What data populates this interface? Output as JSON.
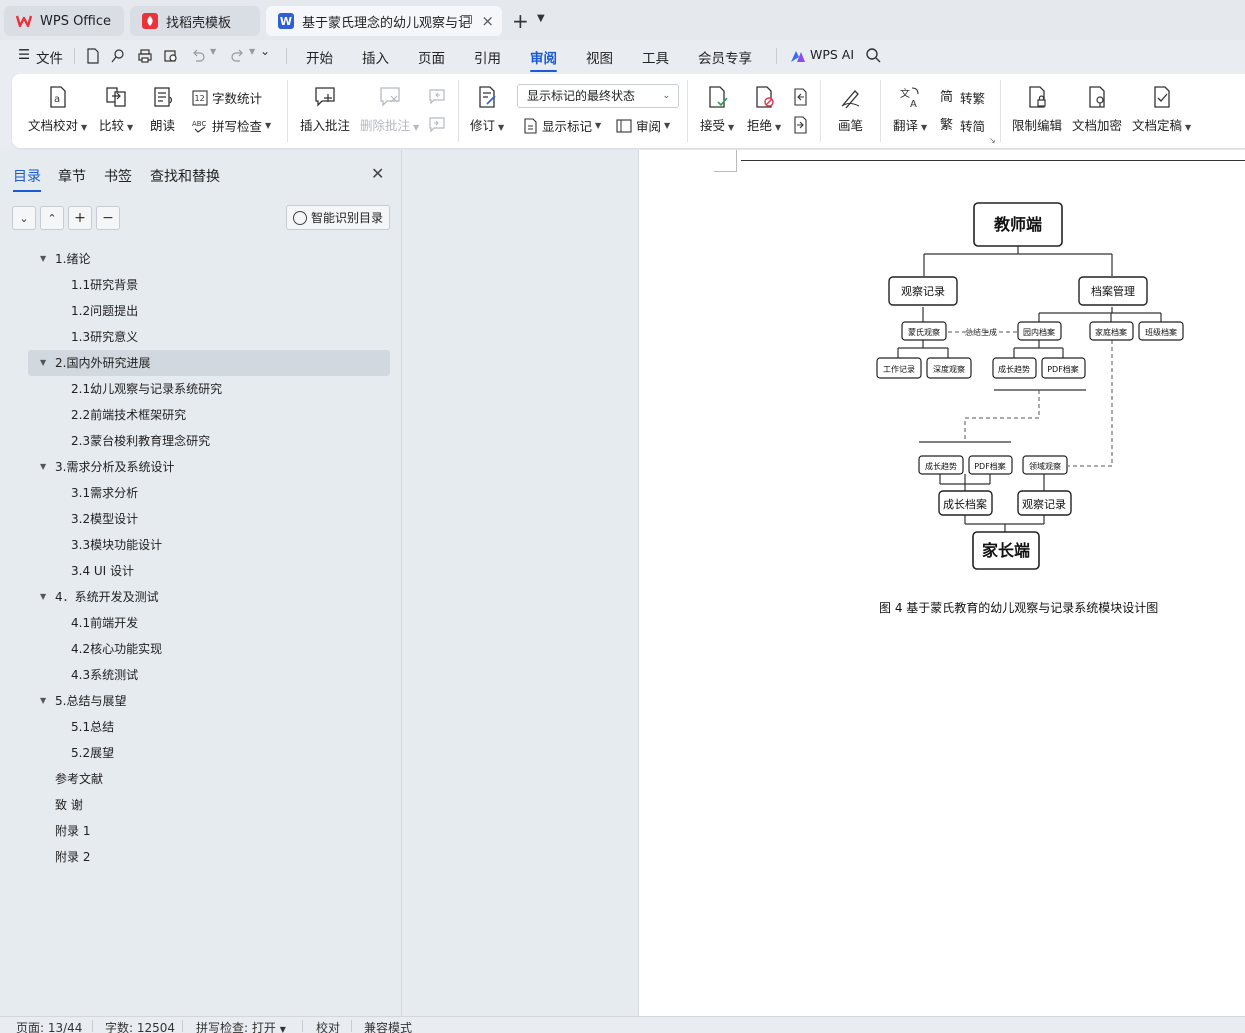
{
  "tabs": [
    {
      "label": "WPS Office"
    },
    {
      "label": "找稻壳模板"
    },
    {
      "label": "基于蒙氏理念的幼儿观察与记录"
    }
  ],
  "menu": {
    "file": "文件",
    "items": [
      "开始",
      "插入",
      "页面",
      "引用",
      "审阅",
      "视图",
      "工具",
      "会员专享"
    ],
    "active": "审阅",
    "ai": "WPS AI"
  },
  "ribbon": {
    "proofread": "文档校对",
    "compare": "比较",
    "read_aloud": "朗读",
    "word_count": "字数统计",
    "spell_check": "拼写检查",
    "insert_comment": "插入批注",
    "delete_comment": "删除批注",
    "track_changes": "修订",
    "markup_state": "显示标记的最终状态",
    "show_markup": "显示标记",
    "review": "审阅",
    "accept": "接受",
    "reject": "拒绝",
    "pen": "画笔",
    "translate": "翻译",
    "to_traditional": "转繁",
    "to_simplified": "转简",
    "restrict_edit": "限制编辑",
    "encrypt": "文档加密",
    "finalize": "文档定稿"
  },
  "nav": {
    "tabs": [
      "目录",
      "章节",
      "书签",
      "查找和替换"
    ],
    "smart_toc": "智能识别目录",
    "toc": [
      {
        "label": "1.绪论",
        "level": 1,
        "expanded": true
      },
      {
        "label": "1.1研究背景",
        "level": 2
      },
      {
        "label": "1.2问题提出",
        "level": 2
      },
      {
        "label": "1.3研究意义",
        "level": 2
      },
      {
        "label": "2.国内外研究进展",
        "level": 1,
        "expanded": true,
        "selected": true
      },
      {
        "label": "2.1幼儿观察与记录系统研究",
        "level": 2
      },
      {
        "label": "2.2前端技术框架研究",
        "level": 2
      },
      {
        "label": "2.3蒙台梭利教育理念研究",
        "level": 2
      },
      {
        "label": "3.需求分析及系统设计",
        "level": 1,
        "expanded": true
      },
      {
        "label": "3.1需求分析",
        "level": 2
      },
      {
        "label": "3.2模型设计",
        "level": 2
      },
      {
        "label": "3.3模块功能设计",
        "level": 2
      },
      {
        "label": "3.4 UI 设计",
        "level": 2
      },
      {
        "label": "4．系统开发及测试",
        "level": 1,
        "expanded": true
      },
      {
        "label": "4.1前端开发",
        "level": 2
      },
      {
        "label": "4.2核心功能实现",
        "level": 2
      },
      {
        "label": "4.3系统测试",
        "level": 2
      },
      {
        "label": "5.总结与展望",
        "level": 1,
        "expanded": true
      },
      {
        "label": "5.1总结",
        "level": 2
      },
      {
        "label": "5.2展望",
        "level": 2
      },
      {
        "label": "参考文献",
        "level": 1
      },
      {
        "label": "致 谢",
        "level": 1
      },
      {
        "label": "附录 1",
        "level": 1
      },
      {
        "label": "附录 2",
        "level": 1
      }
    ]
  },
  "diagram": {
    "teacher": "教师端",
    "observe_record": "观察记录",
    "archive_mgmt": "档案管理",
    "montessori_obs": "蒙氏观察",
    "summary_gen": "总结生成",
    "kindergarten_archive": "园内档案",
    "family_archive": "家庭档案",
    "class_archive": "班级档案",
    "work_record": "工作记录",
    "deep_obs": "深度观察",
    "growth_trend": "成长趋势",
    "pdf_archive": "PDF档案",
    "field_obs": "领域观察",
    "growth_archive": "成长档案",
    "parent": "家长端"
  },
  "caption": "图 4 基于蒙氏教育的幼儿观察与记录系统模块设计图",
  "status": {
    "page": "页面: 13/44",
    "words": "字数: 12504",
    "spell": "拼写检查: 打开",
    "proof": "校对",
    "compat": "兼容模式"
  },
  "colors": {
    "accent": "#1a5ad8",
    "wps_red": "#e8333a",
    "doc_blue": "#2e5fd6"
  }
}
